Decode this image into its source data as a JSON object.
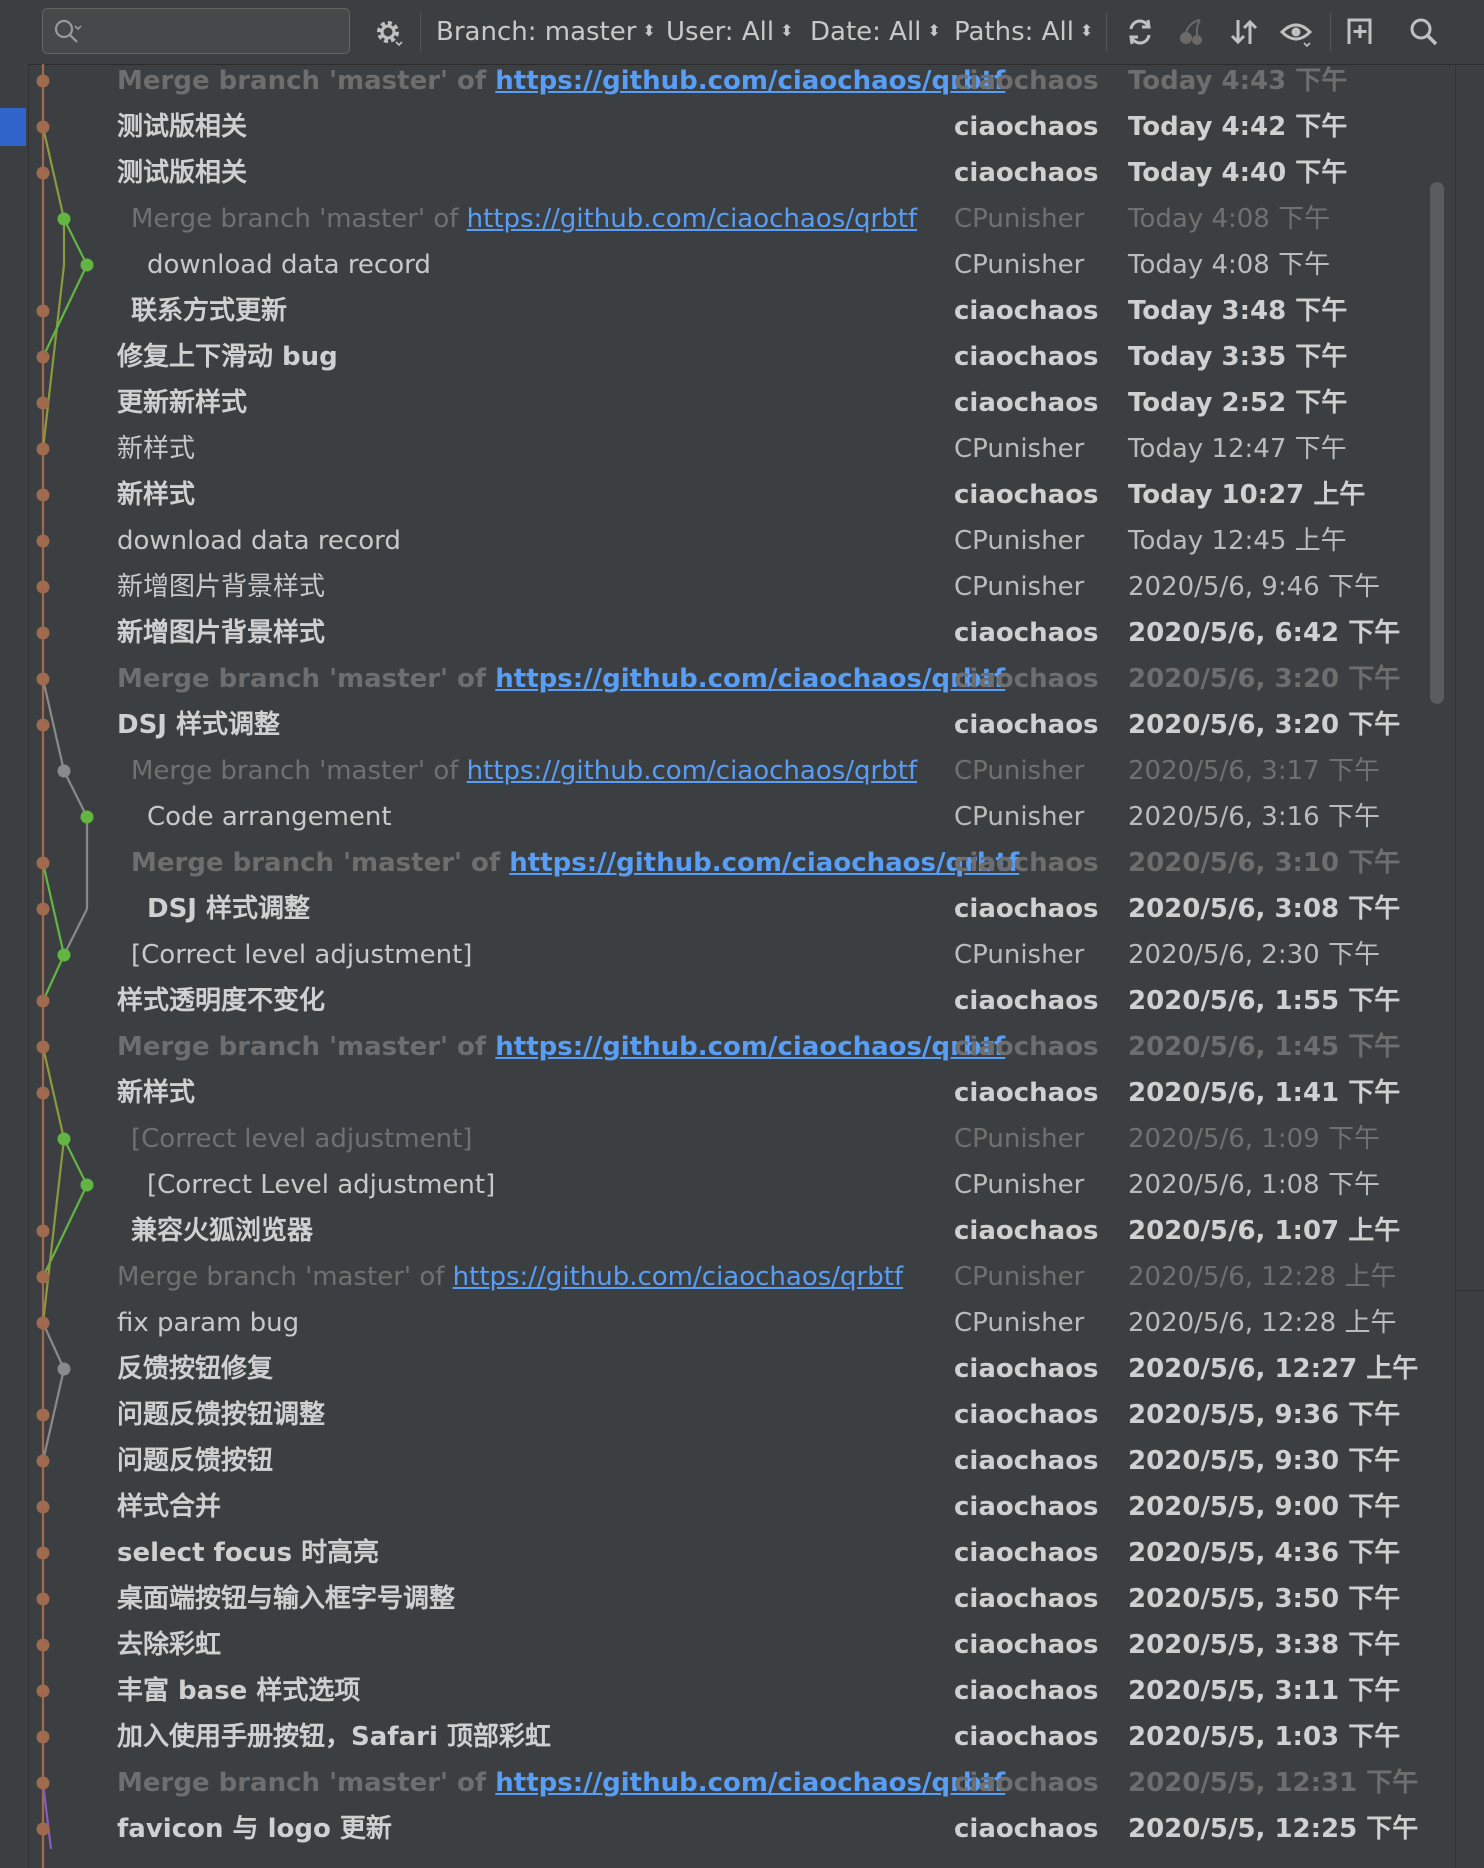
{
  "toolbar": {
    "search": {
      "value": "",
      "placeholder": ""
    },
    "filters": {
      "branch": "Branch: master",
      "user": "User: All",
      "date": "Date: All",
      "paths": "Paths: All"
    },
    "icons": [
      "gear-icon",
      "refresh-icon",
      "cherry-pick-icon",
      "sort-icon",
      "eye-icon",
      "new-tab-icon",
      "search-icon"
    ]
  },
  "colors": {
    "background": "#3c3f41",
    "link": "#589df6",
    "graph_brown": "#a06a4f",
    "graph_olive": "#8a9a3e",
    "graph_green": "#62b543",
    "graph_gray": "#8a8a8a",
    "graph_purple": "#8a5ac0"
  },
  "commits": [
    {
      "pre": "Merge branch 'master' of ",
      "link": "https://github.com/ciaochaos/qrbtf",
      "author": "ciaochaos",
      "date": "Today 4:43 下午",
      "style": "dim bold",
      "indent": 0,
      "lane": 0
    },
    {
      "pre": "测试版相关",
      "link": "",
      "author": "ciaochaos",
      "date": "Today 4:42 下午",
      "style": "bold",
      "indent": 0,
      "lane": 0
    },
    {
      "pre": "测试版相关",
      "link": "",
      "author": "ciaochaos",
      "date": "Today 4:40 下午",
      "style": "bold",
      "indent": 0,
      "lane": 0
    },
    {
      "pre": "Merge branch 'master' of ",
      "link": "https://github.com/ciaochaos/qrbtf",
      "author": "CPunisher",
      "date": "Today 4:08 下午",
      "style": "dim",
      "indent": 1,
      "lane": 1
    },
    {
      "pre": "download data record",
      "link": "",
      "author": "CPunisher",
      "date": "Today 4:08 下午",
      "style": "normal",
      "indent": 2,
      "lane": 2
    },
    {
      "pre": "联系方式更新",
      "link": "",
      "author": "ciaochaos",
      "date": "Today 3:48 下午",
      "style": "bold",
      "indent": 1,
      "lane": 0
    },
    {
      "pre": "修复上下滑动 bug",
      "link": "",
      "author": "ciaochaos",
      "date": "Today 3:35 下午",
      "style": "bold",
      "indent": 0,
      "lane": 0
    },
    {
      "pre": "更新新样式",
      "link": "",
      "author": "ciaochaos",
      "date": "Today 2:52 下午",
      "style": "bold",
      "indent": 0,
      "lane": 0
    },
    {
      "pre": "新样式",
      "link": "",
      "author": "CPunisher",
      "date": "Today 12:47 下午",
      "style": "normal",
      "indent": 0,
      "lane": 0
    },
    {
      "pre": "新样式",
      "link": "",
      "author": "ciaochaos",
      "date": "Today 10:27 上午",
      "style": "bold",
      "indent": 0,
      "lane": 0
    },
    {
      "pre": "download data record",
      "link": "",
      "author": "CPunisher",
      "date": "Today 12:45 上午",
      "style": "normal",
      "indent": 0,
      "lane": 0
    },
    {
      "pre": "新增图片背景样式",
      "link": "",
      "author": "CPunisher",
      "date": "2020/5/6, 9:46 下午",
      "style": "normal",
      "indent": 0,
      "lane": 0
    },
    {
      "pre": "新增图片背景样式",
      "link": "",
      "author": "ciaochaos",
      "date": "2020/5/6, 6:42 下午",
      "style": "bold",
      "indent": 0,
      "lane": 0
    },
    {
      "pre": "Merge branch 'master' of ",
      "link": "https://github.com/ciaochaos/qrbtf",
      "author": "ciaochaos",
      "date": "2020/5/6, 3:20 下午",
      "style": "dim bold",
      "indent": 0,
      "lane": 0
    },
    {
      "pre": "DSJ 样式调整",
      "link": "",
      "author": "ciaochaos",
      "date": "2020/5/6, 3:20 下午",
      "style": "bold",
      "indent": 0,
      "lane": 0
    },
    {
      "pre": "Merge branch 'master' of ",
      "link": "https://github.com/ciaochaos/qrbtf",
      "author": "CPunisher",
      "date": "2020/5/6, 3:17 下午",
      "style": "dim",
      "indent": 1,
      "lane": 1
    },
    {
      "pre": "Code arrangement",
      "link": "",
      "author": "CPunisher",
      "date": "2020/5/6, 3:16 下午",
      "style": "normal",
      "indent": 2,
      "lane": 2
    },
    {
      "pre": "Merge branch 'master' of ",
      "link": "https://github.com/ciaochaos/qrbtf",
      "author": "ciaochaos",
      "date": "2020/5/6, 3:10 下午",
      "style": "dim bold",
      "indent": 1,
      "lane": 0
    },
    {
      "pre": "DSJ 样式调整",
      "link": "",
      "author": "ciaochaos",
      "date": "2020/5/6, 3:08 下午",
      "style": "bold",
      "indent": 2,
      "lane": 0
    },
    {
      "pre": "[Correct level adjustment]",
      "link": "",
      "author": "CPunisher",
      "date": "2020/5/6, 2:30 下午",
      "style": "normal",
      "indent": 1,
      "lane": 1
    },
    {
      "pre": "样式透明度不变化",
      "link": "",
      "author": "ciaochaos",
      "date": "2020/5/6, 1:55 下午",
      "style": "bold",
      "indent": 0,
      "lane": 0
    },
    {
      "pre": "Merge branch 'master' of ",
      "link": "https://github.com/ciaochaos/qrbtf",
      "author": "ciaochaos",
      "date": "2020/5/6, 1:45 下午",
      "style": "dim bold",
      "indent": 0,
      "lane": 0
    },
    {
      "pre": "新样式",
      "link": "",
      "author": "ciaochaos",
      "date": "2020/5/6, 1:41 下午",
      "style": "bold",
      "indent": 0,
      "lane": 0
    },
    {
      "pre": "[Correct level adjustment]",
      "link": "",
      "author": "CPunisher",
      "date": "2020/5/6, 1:09 下午",
      "style": "dim",
      "indent": 1,
      "lane": 1
    },
    {
      "pre": "[Correct Level adjustment]",
      "link": "",
      "author": "CPunisher",
      "date": "2020/5/6, 1:08 下午",
      "style": "normal",
      "indent": 2,
      "lane": 2
    },
    {
      "pre": "兼容火狐浏览器",
      "link": "",
      "author": "ciaochaos",
      "date": "2020/5/6, 1:07 上午",
      "style": "bold",
      "indent": 1,
      "lane": 0
    },
    {
      "pre": "Merge branch 'master' of ",
      "link": "https://github.com/ciaochaos/qrbtf",
      "author": "CPunisher",
      "date": "2020/5/6, 12:28 上午",
      "style": "dim",
      "indent": 0,
      "lane": 0
    },
    {
      "pre": "fix param bug",
      "link": "",
      "author": "CPunisher",
      "date": "2020/5/6, 12:28 上午",
      "style": "normal",
      "indent": 0,
      "lane": 0
    },
    {
      "pre": "反馈按钮修复",
      "link": "",
      "author": "ciaochaos",
      "date": "2020/5/6, 12:27 上午",
      "style": "bold",
      "indent": 0,
      "lane": 1
    },
    {
      "pre": "问题反馈按钮调整",
      "link": "",
      "author": "ciaochaos",
      "date": "2020/5/5, 9:36 下午",
      "style": "bold",
      "indent": 0,
      "lane": 0
    },
    {
      "pre": "问题反馈按钮",
      "link": "",
      "author": "ciaochaos",
      "date": "2020/5/5, 9:30 下午",
      "style": "bold",
      "indent": 0,
      "lane": 0
    },
    {
      "pre": "样式合并",
      "link": "",
      "author": "ciaochaos",
      "date": "2020/5/5, 9:00 下午",
      "style": "bold",
      "indent": 0,
      "lane": 0
    },
    {
      "pre": "select focus 时高亮",
      "link": "",
      "author": "ciaochaos",
      "date": "2020/5/5, 4:36 下午",
      "style": "bold",
      "indent": 0,
      "lane": 0
    },
    {
      "pre": "桌面端按钮与输入框字号调整",
      "link": "",
      "author": "ciaochaos",
      "date": "2020/5/5, 3:50 下午",
      "style": "bold",
      "indent": 0,
      "lane": 0
    },
    {
      "pre": "去除彩虹",
      "link": "",
      "author": "ciaochaos",
      "date": "2020/5/5, 3:38 下午",
      "style": "bold",
      "indent": 0,
      "lane": 0
    },
    {
      "pre": "丰富 base 样式选项",
      "link": "",
      "author": "ciaochaos",
      "date": "2020/5/5, 3:11 下午",
      "style": "bold",
      "indent": 0,
      "lane": 0
    },
    {
      "pre": "加入使用手册按钮，Safari 顶部彩虹",
      "link": "",
      "author": "ciaochaos",
      "date": "2020/5/5, 1:03 下午",
      "style": "bold",
      "indent": 0,
      "lane": 0
    },
    {
      "pre": "Merge branch 'master' of ",
      "link": "https://github.com/ciaochaos/qrbtf",
      "author": "ciaochaos",
      "date": "2020/5/5, 12:31 下午",
      "style": "dim bold",
      "indent": 0,
      "lane": 0
    },
    {
      "pre": "favicon 与 logo 更新",
      "link": "",
      "author": "ciaochaos",
      "date": "2020/5/5, 12:25 下午",
      "style": "bold",
      "indent": 0,
      "lane": 0
    }
  ]
}
